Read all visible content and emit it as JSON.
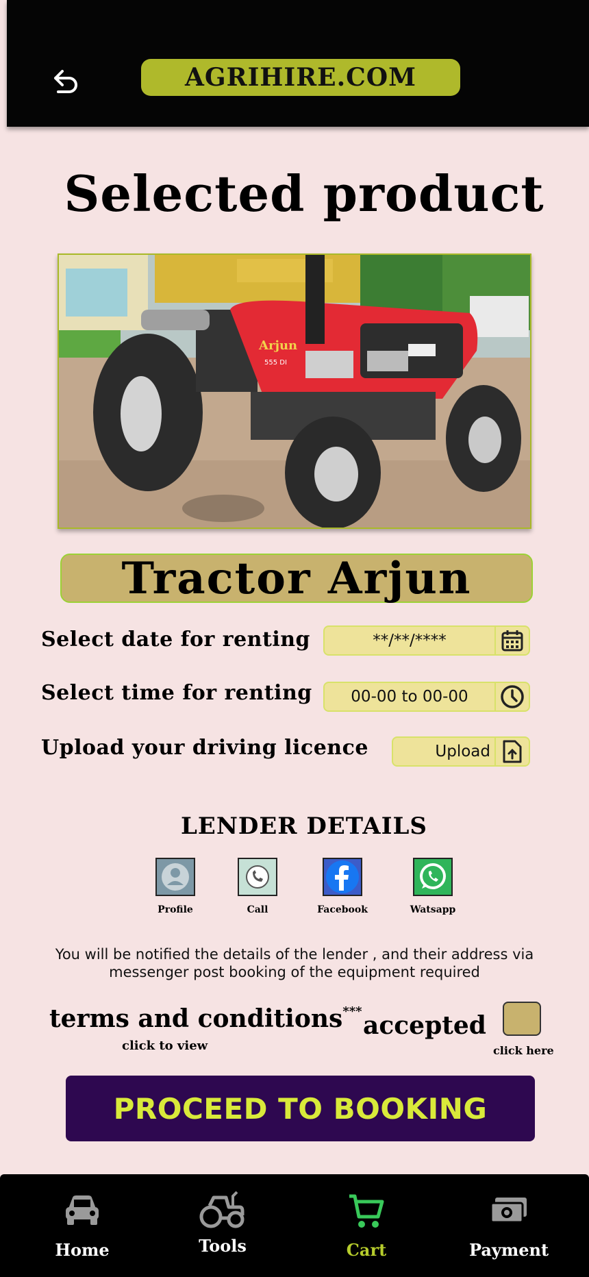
{
  "header": {
    "brand": "AGRIHIRE.COM",
    "back_icon": "back-arrow-icon"
  },
  "page": {
    "title": "Selected product"
  },
  "product": {
    "name": "Tractor Arjun",
    "image_alt": "Mahindra Arjun ultra-1 555 DI tractor",
    "badge_text": "Arjun",
    "model_text": "555 DI"
  },
  "form": {
    "date_label": "Select date for renting",
    "date_value": "**/**/****",
    "time_label": "Select time for renting",
    "time_value": "00-00 to 00-00",
    "licence_label": "Upload your driving licence",
    "upload_label": "Upload"
  },
  "lender": {
    "title": "LENDER DETAILS",
    "items": [
      {
        "label": "Profile"
      },
      {
        "label": "Call"
      },
      {
        "label": "Facebook"
      },
      {
        "label": "Watsapp"
      }
    ],
    "notice": "You will be notified the details of the lender , and their address via messenger post booking of the equipment required"
  },
  "terms": {
    "label": "terms and conditions",
    "mark": "***",
    "click_view": "click to view",
    "accepted": "accepted",
    "click_here": "click here"
  },
  "cta": {
    "proceed": "PROCEED TO BOOKING"
  },
  "nav": {
    "items": [
      {
        "label": "Home",
        "icon": "car-icon"
      },
      {
        "label": "Tools",
        "icon": "tractor-icon"
      },
      {
        "label": "Cart",
        "icon": "cart-icon",
        "active": true
      },
      {
        "label": "Payment",
        "icon": "money-icon"
      }
    ]
  },
  "colors": {
    "background": "#f6e3e3",
    "brand_pill": "#afb92b",
    "product_name_bg": "#c8b26e",
    "field_bg": "#eee39a",
    "cta_bg": "#2e0850",
    "cta_text": "#d9ea3a",
    "nav_active": "#b6cc2c"
  }
}
